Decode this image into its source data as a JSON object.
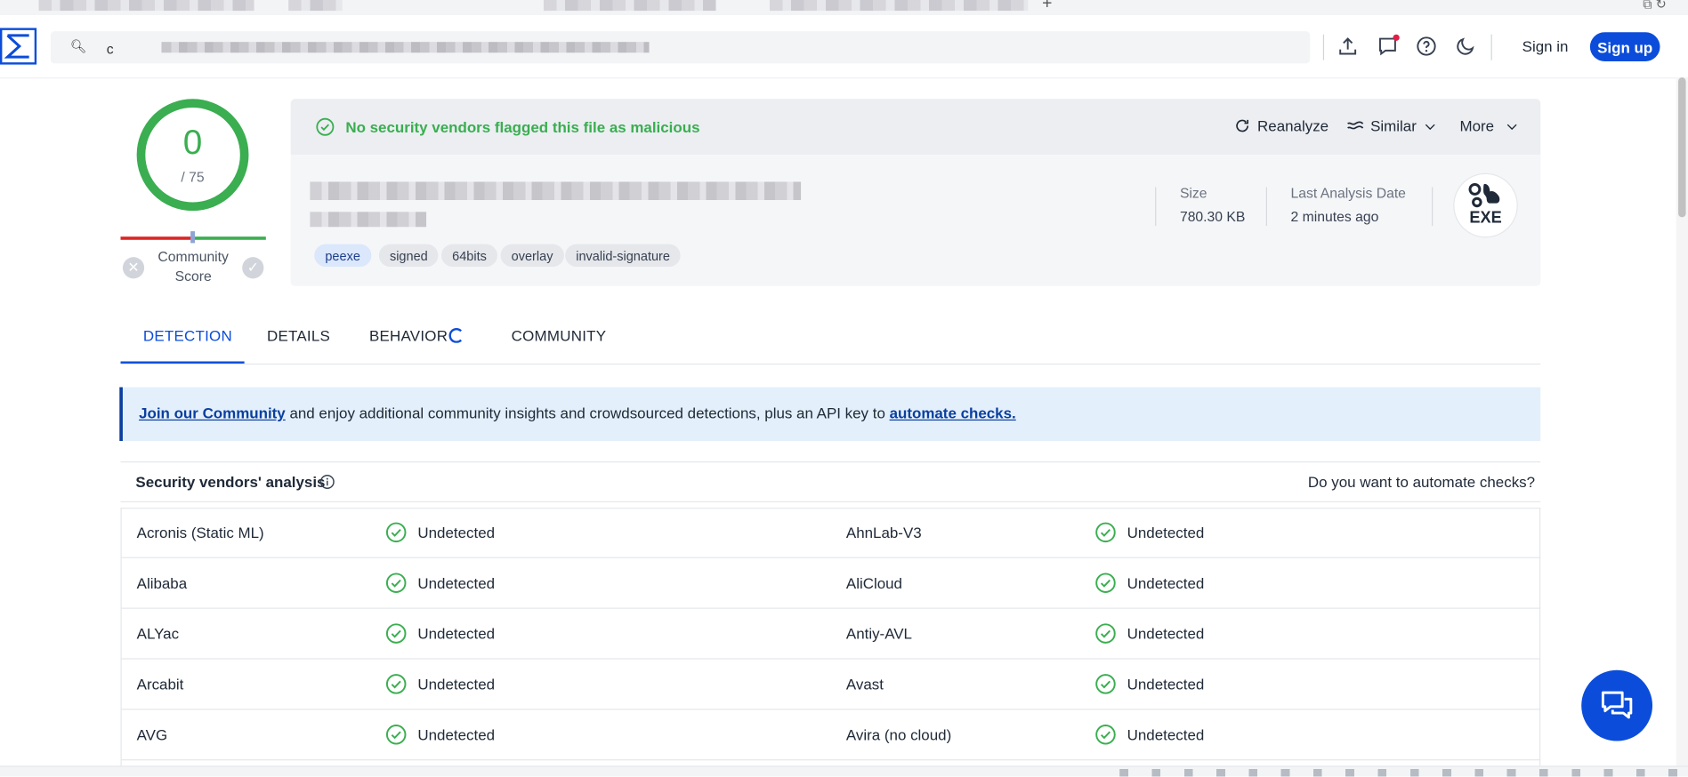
{
  "header": {
    "search_value": "c",
    "sign_in": "Sign in",
    "sign_up": "Sign up",
    "icons": [
      "upload-icon",
      "chat-icon",
      "help-icon",
      "dark-mode-icon"
    ]
  },
  "score": {
    "detections": "0",
    "total": "/ 75",
    "community_label": "Community\nScore"
  },
  "summary": {
    "verdict": "No security vendors flagged this file as malicious",
    "actions": {
      "reanalyze": "Reanalyze",
      "similar": "Similar",
      "more": "More"
    },
    "tags": [
      "peexe",
      "signed",
      "64bits",
      "overlay",
      "invalid-signature"
    ],
    "size_label": "Size",
    "size_value": "780.30 KB",
    "date_label": "Last Analysis Date",
    "date_value": "2 minutes ago",
    "file_type": "EXE"
  },
  "tabs": [
    {
      "label": "DETECTION",
      "active": true
    },
    {
      "label": "DETAILS",
      "active": false
    },
    {
      "label": "BEHAVIOR",
      "active": false
    },
    {
      "label": "COMMUNITY",
      "active": false
    }
  ],
  "banner": {
    "link1": "Join our Community",
    "middle": " and enjoy additional community insights and crowdsourced detections, plus an API key to ",
    "link2": "automate checks."
  },
  "vendors": {
    "title": "Security vendors' analysis",
    "automate_prompt": "Do you want to automate checks?",
    "rows": [
      {
        "left": "Acronis (Static ML)",
        "left_result": "Undetected",
        "right": "AhnLab-V3",
        "right_result": "Undetected"
      },
      {
        "left": "Alibaba",
        "left_result": "Undetected",
        "right": "AliCloud",
        "right_result": "Undetected"
      },
      {
        "left": "ALYac",
        "left_result": "Undetected",
        "right": "Antiy-AVL",
        "right_result": "Undetected"
      },
      {
        "left": "Arcabit",
        "left_result": "Undetected",
        "right": "Avast",
        "right_result": "Undetected"
      },
      {
        "left": "AVG",
        "left_result": "Undetected",
        "right": "Avira (no cloud)",
        "right_result": "Undetected"
      }
    ]
  },
  "colors": {
    "brand": "#0b4dda",
    "clean": "#3aae50",
    "banner_bg": "#e3f0fc"
  }
}
